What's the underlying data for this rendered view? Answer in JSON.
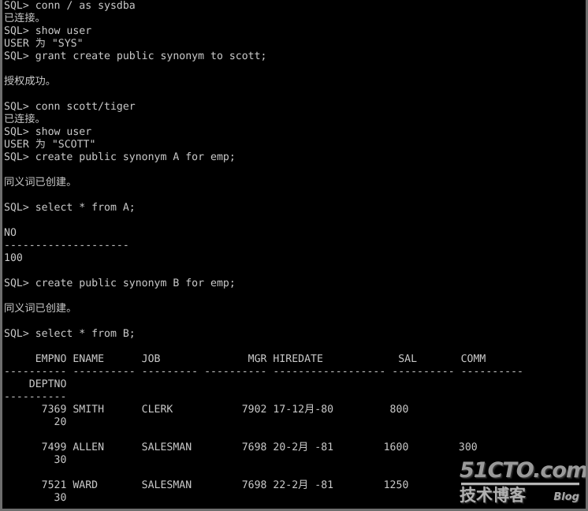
{
  "terminal": {
    "title": "SQL*Plus",
    "prompt": "SQL>",
    "colors": {
      "background": "#000000",
      "foreground": "#c8c8c8",
      "border": "#6e6e6e"
    },
    "lines": [
      "SQL> conn / as sysdba",
      "已连接。",
      "SQL> show user",
      "USER 为 \"SYS\"",
      "SQL> grant create public synonym to scott;",
      "",
      "授权成功。",
      "",
      "SQL> conn scott/tiger",
      "已连接。",
      "SQL> show user",
      "USER 为 \"SCOTT\"",
      "SQL> create public synonym A for emp;",
      "",
      "同义词已创建。",
      "",
      "SQL> select * from A;",
      "",
      "NO",
      "--------------------",
      "100",
      "",
      "SQL> create public synonym B for emp;",
      "",
      "同义词已创建。",
      "",
      "SQL> select * from B;",
      "",
      "     EMPNO ENAME      JOB              MGR HIREDATE            SAL       COMM",
      "---------- ---------- --------- ---------- ------------------ ---------- ----------",
      "    DEPTNO",
      "----------",
      "      7369 SMITH      CLERK           7902 17-12月-80         800",
      "        20",
      "",
      "      7499 ALLEN      SALESMAN        7698 20-2月 -81        1600        300",
      "        30",
      "",
      "      7521 WARD       SALESMAN        7698 22-2月 -81        1250",
      "        30"
    ]
  },
  "commands": [
    {
      "prompt": "SQL>",
      "text": "conn / as sysdba",
      "response": "已连接。"
    },
    {
      "prompt": "SQL>",
      "text": "show user",
      "response": "USER 为 \"SYS\""
    },
    {
      "prompt": "SQL>",
      "text": "grant create public synonym to scott;",
      "response": "授权成功。"
    },
    {
      "prompt": "SQL>",
      "text": "conn scott/tiger",
      "response": "已连接。"
    },
    {
      "prompt": "SQL>",
      "text": "show user",
      "response": "USER 为 \"SCOTT\""
    },
    {
      "prompt": "SQL>",
      "text": "create public synonym A for emp;",
      "response": "同义词已创建。"
    },
    {
      "prompt": "SQL>",
      "text": "select * from A;",
      "response": ""
    },
    {
      "prompt": "SQL>",
      "text": "create public synonym B for emp;",
      "response": "同义词已创建。"
    },
    {
      "prompt": "SQL>",
      "text": "select * from B;",
      "response": ""
    }
  ],
  "result_a": {
    "columns": [
      "NO"
    ],
    "separator": "--------------------",
    "rows": [
      [
        "100"
      ]
    ]
  },
  "result_b": {
    "columns": [
      "EMPNO",
      "ENAME",
      "JOB",
      "MGR",
      "HIREDATE",
      "SAL",
      "COMM",
      "DEPTNO"
    ],
    "rows": [
      {
        "EMPNO": "7369",
        "ENAME": "SMITH",
        "JOB": "CLERK",
        "MGR": "7902",
        "HIREDATE": "17-12月-80",
        "SAL": "800",
        "COMM": "",
        "DEPTNO": "20"
      },
      {
        "EMPNO": "7499",
        "ENAME": "ALLEN",
        "JOB": "SALESMAN",
        "MGR": "7698",
        "HIREDATE": "20-2月 -81",
        "SAL": "1600",
        "COMM": "300",
        "DEPTNO": "30"
      },
      {
        "EMPNO": "7521",
        "ENAME": "WARD",
        "JOB": "SALESMAN",
        "MGR": "7698",
        "HIREDATE": "22-2月 -81",
        "SAL": "1250",
        "COMM": "",
        "DEPTNO": "30"
      }
    ]
  },
  "watermark": {
    "site": "51CTO.com",
    "chinese": "技术博客",
    "blog": "Blog"
  }
}
